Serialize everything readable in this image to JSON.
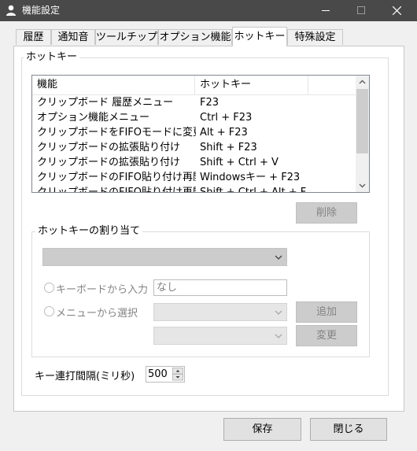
{
  "window": {
    "title": "機能設定",
    "icons": [
      "user-icon",
      "minimize-icon",
      "maximize-icon",
      "close-icon"
    ]
  },
  "tabs": [
    {
      "label": "履歴",
      "active": false
    },
    {
      "label": "通知音",
      "active": false
    },
    {
      "label": "ツールチップ",
      "active": false
    },
    {
      "label": "オプション機能",
      "active": false
    },
    {
      "label": "ホットキー",
      "active": true
    },
    {
      "label": "特殊設定",
      "active": false
    }
  ],
  "hotkey_group": {
    "label": "ホットキー",
    "columns": [
      "機能",
      "ホットキー"
    ],
    "rows": [
      {
        "function": "クリップボード 履歴メニュー",
        "hotkey": "F23"
      },
      {
        "function": "オプション機能メニュー",
        "hotkey": "Ctrl + F23"
      },
      {
        "function": "クリップボードをFIFOモードに変更",
        "hotkey": "Alt + F23"
      },
      {
        "function": "クリップボードの拡張貼り付け",
        "hotkey": "Shift + F23"
      },
      {
        "function": "クリップボードの拡張貼り付け",
        "hotkey": "Shift + Ctrl + V"
      },
      {
        "function": "クリップボードのFIFO貼り付け再開",
        "hotkey": "Windowsキー + F23"
      },
      {
        "function": "クリップボードのFIFO貼り付け再開",
        "hotkey": "Shift + Ctrl + Alt + F"
      }
    ],
    "delete_label": "削除"
  },
  "assign_group": {
    "label": "ホットキーの割り当て",
    "keyboard_label": "キーボードから入力",
    "keyboard_value": "なし",
    "menu_label": "メニューから選択",
    "add_label": "追加",
    "change_label": "変更"
  },
  "interval": {
    "label": "キー連打間隔(ミリ秒)",
    "value": "500"
  },
  "footer": {
    "save_label": "保存",
    "close_label": "閉じる"
  },
  "colors": {
    "titlebar": "#494949",
    "disabled_button": "#cccccc",
    "panel": "#ffffff"
  }
}
